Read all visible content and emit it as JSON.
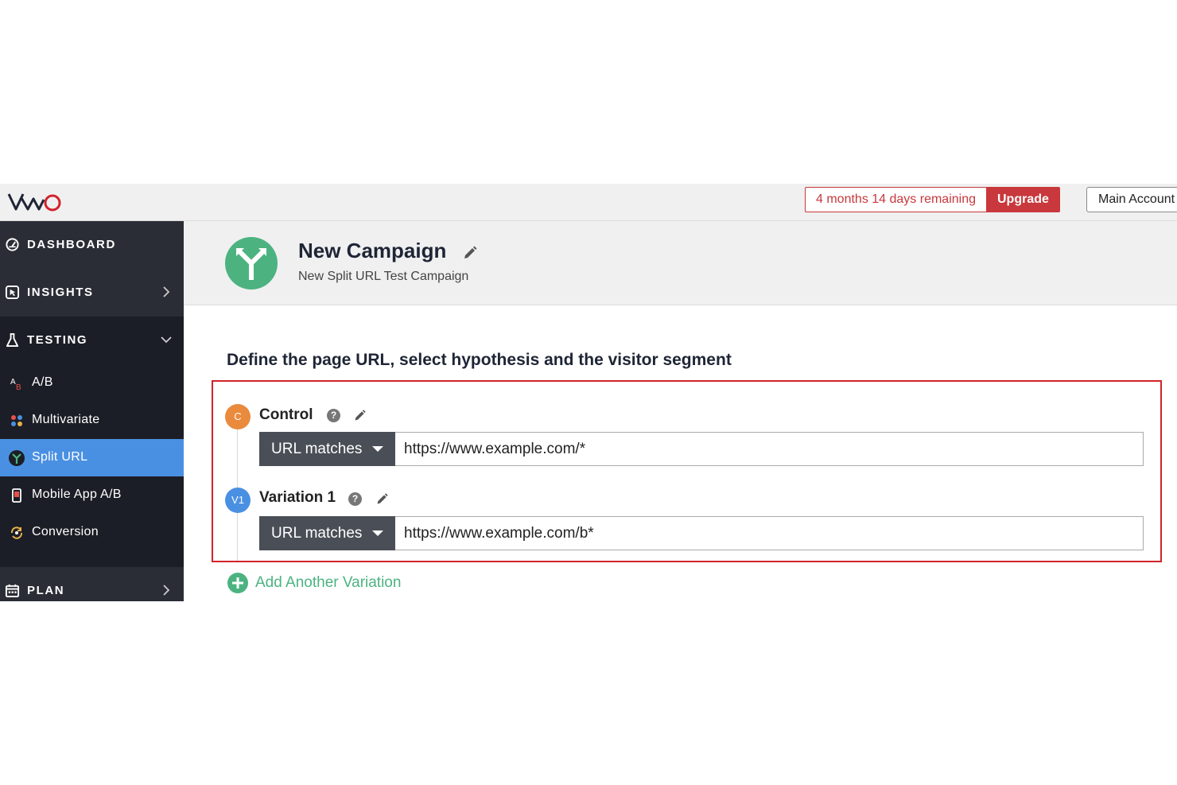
{
  "topbar": {
    "logo_text": "VWO",
    "trial_remaining": "4 months 14 days remaining",
    "upgrade_label": "Upgrade",
    "account_label": "Main Account"
  },
  "sidebar": {
    "sections": [
      {
        "label": "DASHBOARD",
        "icon": "gauge-icon"
      },
      {
        "label": "INSIGHTS",
        "icon": "cursor-box-icon"
      },
      {
        "label": "TESTING",
        "icon": "flask-icon"
      },
      {
        "label": "PLAN",
        "icon": "calendar-icon"
      }
    ],
    "testing_items": [
      {
        "label": "A/B",
        "icon": "ab-icon"
      },
      {
        "label": "Multivariate",
        "icon": "grid-dots-icon"
      },
      {
        "label": "Split URL",
        "icon": "split-arrows-icon",
        "active": true
      },
      {
        "label": "Mobile App A/B",
        "icon": "phone-icon"
      },
      {
        "label": "Conversion",
        "icon": "conversion-icon"
      }
    ]
  },
  "campaign": {
    "title": "New Campaign",
    "subtitle": "New Split URL Test Campaign"
  },
  "main": {
    "heading": "Define the page URL, select hypothesis and the visitor segment",
    "variations": [
      {
        "badge": "C",
        "name": "Control",
        "match_type": "URL matches",
        "url": "https://www.example.com/*"
      },
      {
        "badge": "V1",
        "name": "Variation 1",
        "match_type": "URL matches",
        "url": "https://www.example.com/b*"
      }
    ],
    "add_variation_label": "Add Another Variation"
  },
  "colors": {
    "accent_blue": "#4a90e2",
    "danger_red": "#c8383c",
    "highlight_red": "#d2232a",
    "brand_green": "#4cb380",
    "control_orange": "#ea8a3c",
    "sidebar_bg": "#1b1e26"
  }
}
